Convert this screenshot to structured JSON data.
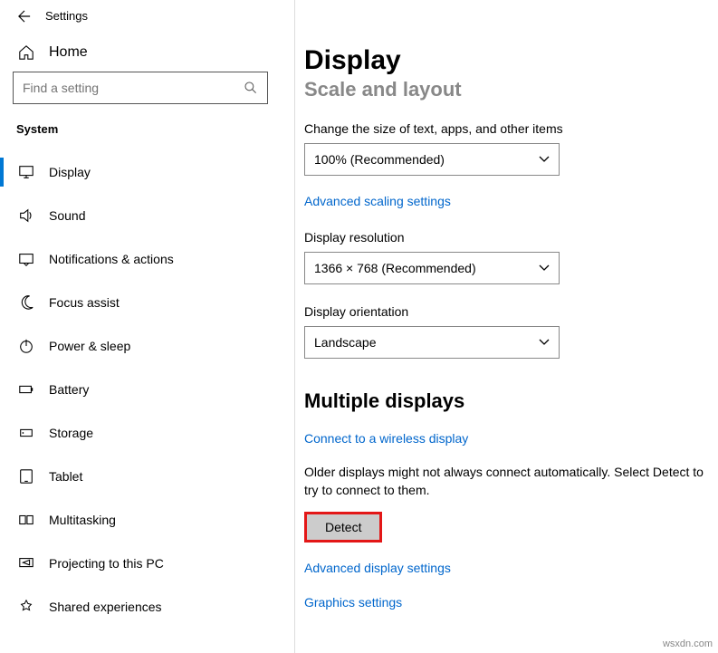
{
  "titlebar": {
    "title": "Settings"
  },
  "sidebar": {
    "home_label": "Home",
    "search_placeholder": "Find a setting",
    "category_label": "System",
    "items": [
      {
        "label": "Display",
        "icon": "display-icon",
        "active": true
      },
      {
        "label": "Sound",
        "icon": "sound-icon"
      },
      {
        "label": "Notifications & actions",
        "icon": "notifications-icon"
      },
      {
        "label": "Focus assist",
        "icon": "focus-icon"
      },
      {
        "label": "Power & sleep",
        "icon": "power-icon"
      },
      {
        "label": "Battery",
        "icon": "battery-icon"
      },
      {
        "label": "Storage",
        "icon": "storage-icon"
      },
      {
        "label": "Tablet",
        "icon": "tablet-icon"
      },
      {
        "label": "Multitasking",
        "icon": "multitasking-icon"
      },
      {
        "label": "Projecting to this PC",
        "icon": "projecting-icon"
      },
      {
        "label": "Shared experiences",
        "icon": "shared-icon"
      }
    ]
  },
  "content": {
    "page_title": "Display",
    "scale_section_label": "Scale and layout",
    "size_label": "Change the size of text, apps, and other items",
    "size_value": "100% (Recommended)",
    "advanced_scaling_link": "Advanced scaling settings",
    "resolution_label": "Display resolution",
    "resolution_value": "1366 × 768 (Recommended)",
    "orientation_label": "Display orientation",
    "orientation_value": "Landscape",
    "multiple_section_label": "Multiple displays",
    "wireless_link": "Connect to a wireless display",
    "detect_desc": "Older displays might not always connect automatically. Select Detect to try to connect to them.",
    "detect_button": "Detect",
    "advanced_display_link": "Advanced display settings",
    "graphics_link": "Graphics settings"
  },
  "watermark": "wsxdn.com"
}
